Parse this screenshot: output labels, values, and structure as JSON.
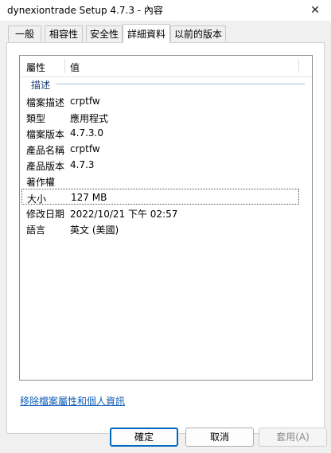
{
  "window": {
    "title": "dynexiontrade Setup 4.7.3 - 內容",
    "close_glyph": "✕"
  },
  "tabs": [
    {
      "label": "一般"
    },
    {
      "label": "相容性"
    },
    {
      "label": "安全性"
    },
    {
      "label": "詳細資料",
      "active": true
    },
    {
      "label": "以前的版本"
    }
  ],
  "details": {
    "column_property": "屬性",
    "column_value": "值",
    "group_description": "描述",
    "rows": [
      {
        "key": "檔案描述",
        "value": "crptfw"
      },
      {
        "key": "類型",
        "value": "應用程式"
      },
      {
        "key": "檔案版本",
        "value": "4.7.3.0"
      },
      {
        "key": "產品名稱",
        "value": "crptfw"
      },
      {
        "key": "產品版本",
        "value": "4.7.3"
      },
      {
        "key": "著作權",
        "value": ""
      },
      {
        "key": "大小",
        "value": "127 MB",
        "selected": true
      },
      {
        "key": "修改日期",
        "value": "2022/10/21 下午 02:57"
      },
      {
        "key": "語言",
        "value": "英文 (美國)"
      }
    ]
  },
  "remove_link": "移除檔案屬性和個人資訊",
  "buttons": {
    "ok": "確定",
    "cancel": "取消",
    "apply": "套用(A)"
  }
}
